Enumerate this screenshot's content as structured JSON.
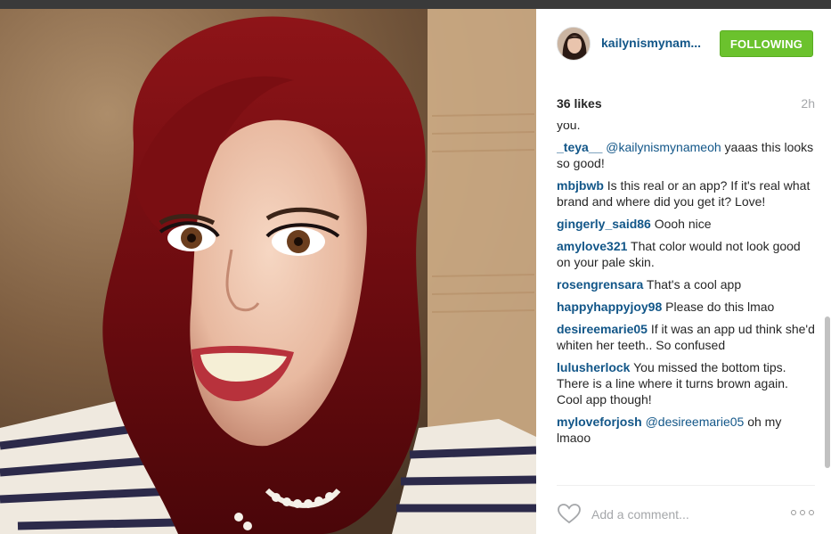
{
  "post": {
    "username": "kailynismynam...",
    "follow_label": "FOLLOWING",
    "likes": "36 likes",
    "time": "2h",
    "comment_placeholder": "Add a comment..."
  },
  "comments": [
    {
      "text": "you."
    },
    {
      "user": "_teya__",
      "mention": "@kailynismynameoh",
      "text": " yaaas this looks so good!"
    },
    {
      "user": "mbjbwb",
      "text": " Is this real or an app? If it's real what brand and where did you get it? Love!"
    },
    {
      "user": "gingerly_said86",
      "text": " Oooh nice"
    },
    {
      "user": "amylove321",
      "text": " That color would not look good on your pale skin."
    },
    {
      "user": "rosengrensara",
      "text": " That's a cool app"
    },
    {
      "user": "happyhappyjoy98",
      "text": " Please do this lmao"
    },
    {
      "user": "desireemarie05",
      "text": " If it was an app ud think she'd whiten her teeth.. So confused"
    },
    {
      "user": "lulusherlock",
      "text": " You missed the bottom tips. There is a line where it turns brown again. Cool app though!"
    },
    {
      "user": "myloveforjosh",
      "mention": "@desireemarie05",
      "text": " oh my lmaoo"
    }
  ],
  "icons": {
    "heart": "heart-outline-icon",
    "more": "more-options-icon"
  },
  "colors": {
    "username": "#125688",
    "follow_button": "#6bc22d",
    "muted": "#a5a7aa"
  }
}
